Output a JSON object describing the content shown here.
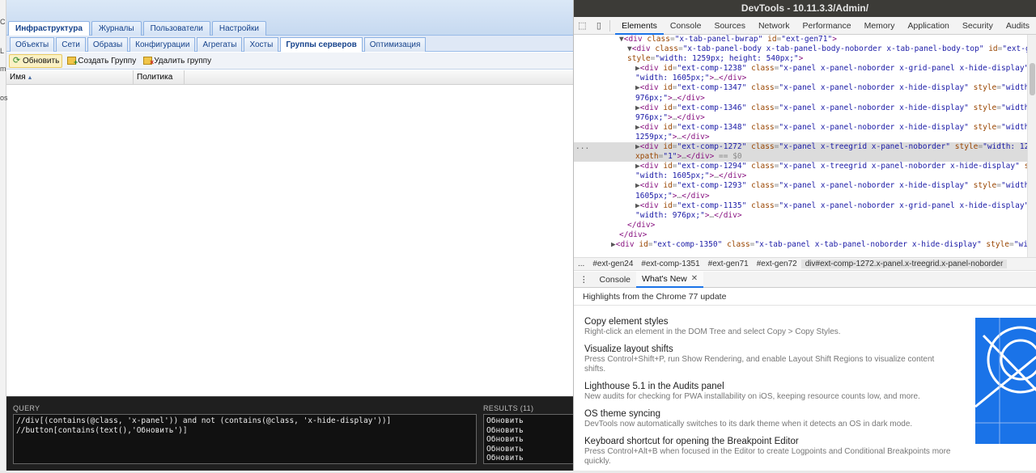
{
  "app": {
    "main_tabs": [
      {
        "label": "Инфраструктура",
        "active": true
      },
      {
        "label": "Журналы",
        "active": false
      },
      {
        "label": "Пользователи",
        "active": false
      },
      {
        "label": "Настройки",
        "active": false
      }
    ],
    "sub_tabs": [
      {
        "label": "Объекты",
        "active": false
      },
      {
        "label": "Сети",
        "active": false
      },
      {
        "label": "Образы",
        "active": false
      },
      {
        "label": "Конфигурации",
        "active": false
      },
      {
        "label": "Агрегаты",
        "active": false
      },
      {
        "label": "Хосты",
        "active": false
      },
      {
        "label": "Группы серверов",
        "active": true
      },
      {
        "label": "Оптимизация",
        "active": false
      }
    ],
    "toolbar": {
      "refresh_label": "Обновить",
      "create_label": "Создать Группу",
      "delete_label": "Удалить группу"
    },
    "grid": {
      "col_name": "Имя",
      "col_policy": "Политика"
    },
    "edge_fragments": [
      "C",
      "L",
      "m",
      "os"
    ]
  },
  "query_panel": {
    "query_label": "QUERY",
    "results_label": "RESULTS (11)",
    "query_lines": [
      "//div[(contains(@class, 'x-panel')) and not (contains(@class, 'x-hide-display'))]",
      "//button[contains(text(),'Обновить')]"
    ],
    "results": [
      "Обновить",
      "Обновить",
      "Обновить",
      "Обновить",
      "Обновить"
    ]
  },
  "devtools": {
    "title": "DevTools - 10.11.3.3/Admin/",
    "tabs": [
      {
        "label": "Elements",
        "active": true
      },
      {
        "label": "Console",
        "active": false
      },
      {
        "label": "Sources",
        "active": false
      },
      {
        "label": "Network",
        "active": false
      },
      {
        "label": "Performance",
        "active": false
      },
      {
        "label": "Memory",
        "active": false
      },
      {
        "label": "Application",
        "active": false
      },
      {
        "label": "Security",
        "active": false
      },
      {
        "label": "Audits",
        "active": false
      }
    ],
    "dom_lines": [
      {
        "indent": 5,
        "arrow": "▼",
        "parts": [
          [
            "tg",
            "<div "
          ],
          [
            "at",
            "class"
          ],
          [
            "eq",
            "="
          ],
          [
            "av",
            "\"x-tab-panel-bwrap\""
          ],
          [
            "tg",
            " "
          ],
          [
            "at",
            "id"
          ],
          [
            "eq",
            "="
          ],
          [
            "av",
            "\"ext-gen71\""
          ],
          [
            "tg",
            ">"
          ]
        ]
      },
      {
        "indent": 6,
        "arrow": "▼",
        "parts": [
          [
            "tg",
            "<div "
          ],
          [
            "at",
            "class"
          ],
          [
            "eq",
            "="
          ],
          [
            "av",
            "\"x-tab-panel-body x-tab-panel-body-noborder x-tab-panel-body-top\""
          ],
          [
            "tg",
            " "
          ],
          [
            "at",
            "id"
          ],
          [
            "eq",
            "="
          ],
          [
            "av",
            "\"ext-gen72\""
          ]
        ]
      },
      {
        "indent": 6,
        "arrow": "",
        "parts": [
          [
            "at",
            "style"
          ],
          [
            "eq",
            "="
          ],
          [
            "av",
            "\"width: 1259px; height: 540px;\""
          ],
          [
            "tg",
            ">"
          ]
        ]
      },
      {
        "indent": 7,
        "arrow": "▶",
        "parts": [
          [
            "tg",
            "<div "
          ],
          [
            "at",
            "id"
          ],
          [
            "eq",
            "="
          ],
          [
            "av",
            "\"ext-comp-1238\""
          ],
          [
            "tg",
            " "
          ],
          [
            "at",
            "class"
          ],
          [
            "eq",
            "="
          ],
          [
            "av",
            "\"x-panel x-panel-noborder x-grid-panel x-hide-display\""
          ],
          [
            "tg",
            " "
          ],
          [
            "at",
            "style"
          ],
          [
            "eq",
            "="
          ]
        ]
      },
      {
        "indent": 7,
        "arrow": "",
        "parts": [
          [
            "av",
            "\"width: 1605px;\""
          ],
          [
            "tg",
            ">"
          ],
          [
            "eq",
            "…"
          ],
          [
            "tg",
            "</div>"
          ]
        ]
      },
      {
        "indent": 7,
        "arrow": "▶",
        "parts": [
          [
            "tg",
            "<div "
          ],
          [
            "at",
            "id"
          ],
          [
            "eq",
            "="
          ],
          [
            "av",
            "\"ext-comp-1347\""
          ],
          [
            "tg",
            " "
          ],
          [
            "at",
            "class"
          ],
          [
            "eq",
            "="
          ],
          [
            "av",
            "\"x-panel x-panel-noborder x-hide-display\""
          ],
          [
            "tg",
            " "
          ],
          [
            "at",
            "style"
          ],
          [
            "eq",
            "="
          ],
          [
            "av",
            "\"width:"
          ]
        ]
      },
      {
        "indent": 7,
        "arrow": "",
        "parts": [
          [
            "av",
            "976px;\""
          ],
          [
            "tg",
            ">"
          ],
          [
            "eq",
            "…"
          ],
          [
            "tg",
            "</div>"
          ]
        ]
      },
      {
        "indent": 7,
        "arrow": "▶",
        "parts": [
          [
            "tg",
            "<div "
          ],
          [
            "at",
            "id"
          ],
          [
            "eq",
            "="
          ],
          [
            "av",
            "\"ext-comp-1346\""
          ],
          [
            "tg",
            " "
          ],
          [
            "at",
            "class"
          ],
          [
            "eq",
            "="
          ],
          [
            "av",
            "\"x-panel x-panel-noborder x-hide-display\""
          ],
          [
            "tg",
            " "
          ],
          [
            "at",
            "style"
          ],
          [
            "eq",
            "="
          ],
          [
            "av",
            "\"width:"
          ]
        ]
      },
      {
        "indent": 7,
        "arrow": "",
        "parts": [
          [
            "av",
            "976px;\""
          ],
          [
            "tg",
            ">"
          ],
          [
            "eq",
            "…"
          ],
          [
            "tg",
            "</div>"
          ]
        ]
      },
      {
        "indent": 7,
        "arrow": "▶",
        "parts": [
          [
            "tg",
            "<div "
          ],
          [
            "at",
            "id"
          ],
          [
            "eq",
            "="
          ],
          [
            "av",
            "\"ext-comp-1348\""
          ],
          [
            "tg",
            " "
          ],
          [
            "at",
            "class"
          ],
          [
            "eq",
            "="
          ],
          [
            "av",
            "\"x-panel x-panel-noborder x-hide-display\""
          ],
          [
            "tg",
            " "
          ],
          [
            "at",
            "style"
          ],
          [
            "eq",
            "="
          ],
          [
            "av",
            "\"width:"
          ]
        ]
      },
      {
        "indent": 7,
        "arrow": "",
        "parts": [
          [
            "av",
            "1259px;\""
          ],
          [
            "tg",
            ">"
          ],
          [
            "eq",
            "…"
          ],
          [
            "tg",
            "</div>"
          ]
        ]
      },
      {
        "indent": 7,
        "arrow": "▶",
        "sel": true,
        "parts": [
          [
            "tg",
            "<div "
          ],
          [
            "at",
            "id"
          ],
          [
            "eq",
            "="
          ],
          [
            "av",
            "\"ext-comp-1272\""
          ],
          [
            "tg",
            " "
          ],
          [
            "at",
            "class"
          ],
          [
            "eq",
            "="
          ],
          [
            "av",
            "\"x-panel x-treegrid x-panel-noborder\""
          ],
          [
            "tg",
            " "
          ],
          [
            "at",
            "style"
          ],
          [
            "eq",
            "="
          ],
          [
            "av",
            "\"width: 1259px;\""
          ]
        ]
      },
      {
        "indent": 7,
        "arrow": "",
        "sel": true,
        "parts": [
          [
            "at",
            "xpath"
          ],
          [
            "eq",
            "="
          ],
          [
            "av",
            "\"1\""
          ],
          [
            "tg",
            ">"
          ],
          [
            "eq",
            "…"
          ],
          [
            "tg",
            "</div>"
          ],
          [
            "eq",
            " == $0"
          ]
        ]
      },
      {
        "indent": 7,
        "arrow": "▶",
        "parts": [
          [
            "tg",
            "<div "
          ],
          [
            "at",
            "id"
          ],
          [
            "eq",
            "="
          ],
          [
            "av",
            "\"ext-comp-1294\""
          ],
          [
            "tg",
            " "
          ],
          [
            "at",
            "class"
          ],
          [
            "eq",
            "="
          ],
          [
            "av",
            "\"x-panel x-treegrid x-panel-noborder x-hide-display\""
          ],
          [
            "tg",
            " "
          ],
          [
            "at",
            "style"
          ],
          [
            "eq",
            "="
          ]
        ]
      },
      {
        "indent": 7,
        "arrow": "",
        "parts": [
          [
            "av",
            "\"width: 1605px;\""
          ],
          [
            "tg",
            ">"
          ],
          [
            "eq",
            "…"
          ],
          [
            "tg",
            "</div>"
          ]
        ]
      },
      {
        "indent": 7,
        "arrow": "▶",
        "parts": [
          [
            "tg",
            "<div "
          ],
          [
            "at",
            "id"
          ],
          [
            "eq",
            "="
          ],
          [
            "av",
            "\"ext-comp-1293\""
          ],
          [
            "tg",
            " "
          ],
          [
            "at",
            "class"
          ],
          [
            "eq",
            "="
          ],
          [
            "av",
            "\"x-panel x-panel-noborder x-hide-display\""
          ],
          [
            "tg",
            " "
          ],
          [
            "at",
            "style"
          ],
          [
            "eq",
            "="
          ],
          [
            "av",
            "\"width:"
          ]
        ]
      },
      {
        "indent": 7,
        "arrow": "",
        "parts": [
          [
            "av",
            "1605px;\""
          ],
          [
            "tg",
            ">"
          ],
          [
            "eq",
            "…"
          ],
          [
            "tg",
            "</div>"
          ]
        ]
      },
      {
        "indent": 7,
        "arrow": "▶",
        "parts": [
          [
            "tg",
            "<div "
          ],
          [
            "at",
            "id"
          ],
          [
            "eq",
            "="
          ],
          [
            "av",
            "\"ext-comp-1135\""
          ],
          [
            "tg",
            " "
          ],
          [
            "at",
            "class"
          ],
          [
            "eq",
            "="
          ],
          [
            "av",
            "\"x-panel x-panel-noborder x-grid-panel x-hide-display\""
          ],
          [
            "tg",
            " "
          ],
          [
            "at",
            "style"
          ],
          [
            "eq",
            "="
          ]
        ]
      },
      {
        "indent": 7,
        "arrow": "",
        "parts": [
          [
            "av",
            "\"width: 976px;\""
          ],
          [
            "tg",
            ">"
          ],
          [
            "eq",
            "…"
          ],
          [
            "tg",
            "</div>"
          ]
        ]
      },
      {
        "indent": 6,
        "arrow": "",
        "parts": [
          [
            "tg",
            "</div>"
          ]
        ]
      },
      {
        "indent": 5,
        "arrow": "",
        "parts": [
          [
            "tg",
            "</div>"
          ]
        ]
      },
      {
        "indent": 4,
        "arrow": "▶",
        "parts": [
          [
            "tg",
            "<div "
          ],
          [
            "at",
            "id"
          ],
          [
            "eq",
            "="
          ],
          [
            "av",
            "\"ext-comp-1350\""
          ],
          [
            "tg",
            " "
          ],
          [
            "at",
            "class"
          ],
          [
            "eq",
            "="
          ],
          [
            "av",
            "\"x-tab-panel x-tab-panel-noborder x-hide-display\""
          ],
          [
            "tg",
            " "
          ],
          [
            "at",
            "style"
          ],
          [
            "eq",
            "="
          ],
          [
            "av",
            "\"width:"
          ]
        ]
      }
    ],
    "breadcrumbs": [
      {
        "label": "...",
        "active": false
      },
      {
        "label": "#ext-gen24",
        "active": false
      },
      {
        "label": "#ext-comp-1351",
        "active": false
      },
      {
        "label": "#ext-gen71",
        "active": false
      },
      {
        "label": "#ext-gen72",
        "active": false
      },
      {
        "label": "div#ext-comp-1272.x-panel.x-treegrid.x-panel-noborder",
        "active": true
      }
    ],
    "drawer": {
      "console_label": "Console",
      "whats_new_label": "What's New",
      "banner": "Highlights from the Chrome 77 update",
      "items": [
        {
          "title": "Copy element styles",
          "desc": "Right-click an element in the DOM Tree and select Copy > Copy Styles."
        },
        {
          "title": "Visualize layout shifts",
          "desc": "Press Control+Shift+P, run Show Rendering, and enable Layout Shift Regions to visualize content shifts."
        },
        {
          "title": "Lighthouse 5.1 in the Audits panel",
          "desc": "New audits for checking for PWA installability on iOS, keeping resource counts low, and more."
        },
        {
          "title": "OS theme syncing",
          "desc": "DevTools now automatically switches to its dark theme when it detects an OS in dark mode."
        },
        {
          "title": "Keyboard shortcut for opening the Breakpoint Editor",
          "desc": "Press Control+Alt+B when focused in the Editor to create Logpoints and Conditional Breakpoints more quickly."
        }
      ]
    }
  },
  "colors": {
    "accent": "#1a73e8",
    "ext_tab_text": "#15428b",
    "ext_header": "#c6d9f0",
    "query_bg": "#1f1f1f"
  }
}
